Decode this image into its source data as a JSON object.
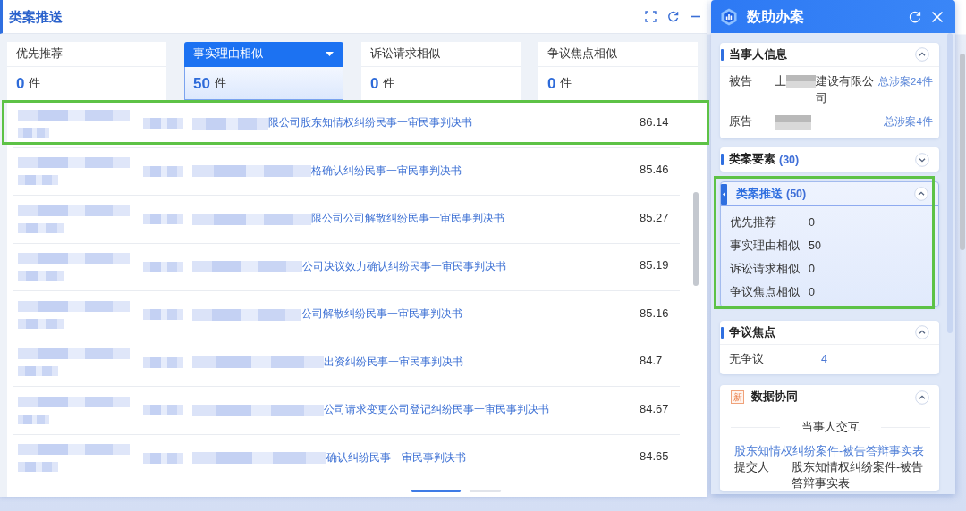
{
  "main": {
    "title": "类案推送"
  },
  "tabs": [
    {
      "label": "优先推荐",
      "count": "0",
      "unit": "件",
      "selected": false
    },
    {
      "label": "事实理由相似",
      "count": "50",
      "unit": "件",
      "selected": true
    },
    {
      "label": "诉讼请求相似",
      "count": "0",
      "unit": "件",
      "selected": false
    },
    {
      "label": "争议焦点相似",
      "count": "0",
      "unit": "件",
      "selected": false
    }
  ],
  "results": [
    {
      "title": "限公司股东知情权纠纷民事一审民事判决书",
      "score": "86.14",
      "highlighted": true
    },
    {
      "title": "格确认纠纷民事一审民事判决书",
      "score": "85.46",
      "highlighted": false
    },
    {
      "title": "限公司公司解散纠纷民事一审民事判决书",
      "score": "85.27",
      "highlighted": false
    },
    {
      "title": "公司决议效力确认纠纷民事一审民事判决书",
      "score": "85.19",
      "highlighted": false
    },
    {
      "title": "公司解散纠纷民事一审民事判决书",
      "score": "85.16",
      "highlighted": false
    },
    {
      "title": "出资纠纷民事一审民事判决书",
      "score": "84.7",
      "highlighted": false
    },
    {
      "title": "公司请求变更公司登记纠纷民事一审民事判决书",
      "score": "84.67",
      "highlighted": false
    },
    {
      "title": "确认纠纷民事一审民事判决书",
      "score": "84.65",
      "highlighted": false
    }
  ],
  "assistant": {
    "title": "数助办案",
    "parties": {
      "title": "当事人信息",
      "expanded": true,
      "selected": false,
      "highlighted": false,
      "rows": [
        {
          "role": "被告",
          "name_start": "上",
          "name_end": "建设有限公司",
          "cases": "总涉案24件"
        },
        {
          "role": "原告",
          "cases": "总涉案4件"
        }
      ]
    },
    "elements": {
      "title": "类案要素",
      "count": "(30)",
      "expanded": false,
      "selected": false,
      "highlighted": false
    },
    "similar": {
      "title": "类案推送",
      "count": "(50)",
      "expanded": true,
      "selected": true,
      "highlighted": true,
      "rows": [
        {
          "label": "优先推荐",
          "value": "0"
        },
        {
          "label": "事实理由相似",
          "value": "50"
        },
        {
          "label": "诉讼请求相似",
          "value": "0"
        },
        {
          "label": "争议焦点相似",
          "value": "0"
        }
      ]
    },
    "disputes": {
      "title": "争议焦点",
      "expanded": true,
      "selected": false,
      "highlighted": false,
      "rows": [
        {
          "label": "无争议",
          "value": "4"
        }
      ]
    },
    "collab": {
      "badge": "新",
      "title": "数据协同",
      "expanded": true,
      "selected": false,
      "highlighted": false,
      "divider_label": "当事人交互",
      "link": "股东知情权纠纷案件-被告答辩事实表",
      "rows": [
        {
          "label": "提交人",
          "value": "股东知情权纠纷案件-被告答辩事实表"
        }
      ]
    }
  }
}
